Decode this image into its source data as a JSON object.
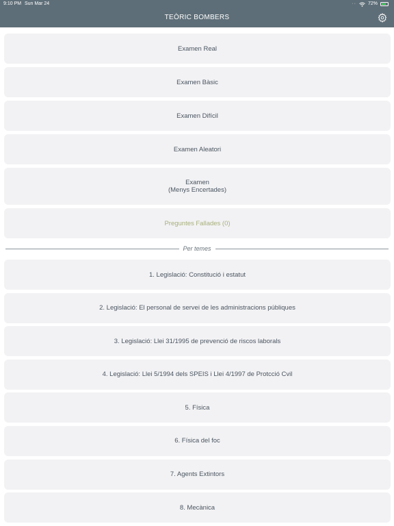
{
  "status_bar": {
    "time": "9:10 PM",
    "date": "Sun Mar 24",
    "battery_text": "72%",
    "battery_level": 0.72
  },
  "nav": {
    "title": "TEÒRIC BOMBERS",
    "settings_icon": "gear-icon"
  },
  "exams": [
    {
      "label": "Examen Real"
    },
    {
      "label": "Examen Bàsic"
    },
    {
      "label": "Examen Difícil"
    },
    {
      "label": "Examen Aleatori"
    },
    {
      "label_line1": "Examen",
      "label_line2": "(Menys Encertades)"
    },
    {
      "label": "Preguntes Fallades (0)"
    }
  ],
  "section_label": "Per temes",
  "topics": [
    {
      "label": "1. Legislació: Constitució i estatut"
    },
    {
      "label": "2. Legislació: El personal de servei de les administracions públiques"
    },
    {
      "label": "3. Legislació: Llei 31/1995 de prevenció de riscos laborals"
    },
    {
      "label": "4. Legislació: Llei 5/1994 dels SPEIS i Llei 4/1997 de Protcció Cvil"
    },
    {
      "label": "5. Física"
    },
    {
      "label": "6. Física del foc"
    },
    {
      "label": "7. Agents Extintors"
    },
    {
      "label": "8. Mecànica"
    }
  ],
  "colors": {
    "nav_background": "#5e6e78",
    "row_background": "#f2f2f4",
    "failed_text": "#a7b07a",
    "battery_fill": "#4cd964"
  }
}
